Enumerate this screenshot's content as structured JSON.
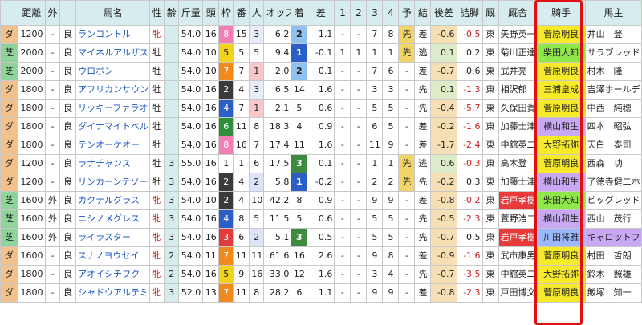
{
  "headers": [
    "",
    "距離",
    "外",
    "",
    "馬名",
    "性",
    "齢",
    "斤量",
    "頭",
    "枠",
    "番",
    "人",
    "オッズ",
    "着",
    "差",
    "1",
    "2",
    "3",
    "4",
    "予",
    "結",
    "後差",
    "詰脚",
    "厩",
    "厩舎",
    "騎手",
    "馬主"
  ],
  "rows": [
    {
      "surf": "ダ",
      "dist": "1200",
      "out": "-",
      "cond": "良",
      "horse": "ランコントル",
      "sex": "牝",
      "age": "",
      "kin": "54.0",
      "tou": "16",
      "waku": "8",
      "ban": "15",
      "pop": "3",
      "odds": "6.2",
      "chaku": "2",
      "sa": "1.1",
      "p1": "-",
      "p2": "-",
      "p3": "7",
      "p4": "8",
      "yo": "先",
      "ke": "差",
      "ato": "-0.6",
      "tsu": "-0.5",
      "umaya": "東",
      "kyu": "矢野英一",
      "jock": "菅原明良",
      "owner": "井山　登"
    },
    {
      "surf": "芝",
      "dist": "2000",
      "out": "-",
      "cond": "良",
      "horse": "マイネルアルザス",
      "sex": "牡",
      "age": "",
      "kin": "54.0",
      "tou": "10",
      "waku": "5",
      "ban": "5",
      "pop": "5",
      "odds": "9.4",
      "chaku": "1",
      "sa": "-0.1",
      "p1": "1",
      "p2": "1",
      "p3": "1",
      "p4": "1",
      "yo": "先",
      "ke": "逃",
      "ato": "0.1",
      "tsu": "0.2",
      "umaya": "東",
      "kyu": "菊川正達",
      "jock": "柴田大知",
      "owner": "サラブレッド"
    },
    {
      "surf": "芝",
      "dist": "2000",
      "out": "-",
      "cond": "良",
      "horse": "ウロボン",
      "sex": "牡",
      "age": "",
      "kin": "54.0",
      "tou": "10",
      "waku": "7",
      "ban": "7",
      "pop": "1",
      "odds": "2.0",
      "chaku": "2",
      "sa": "0.1",
      "p1": "-",
      "p2": "-",
      "p3": "7",
      "p4": "6",
      "yo": "-",
      "ke": "差",
      "ato": "-0.7",
      "tsu": "0.6",
      "umaya": "東",
      "kyu": "武井亮",
      "jock": "菅原明良",
      "owner": "村木　隆"
    },
    {
      "surf": "ダ",
      "dist": "1800",
      "out": "-",
      "cond": "良",
      "horse": "アフリカンサウンズ",
      "sex": "牡",
      "age": "",
      "kin": "54.0",
      "tou": "16",
      "waku": "2",
      "ban": "4",
      "pop": "3",
      "odds": "6.5",
      "chaku": "14",
      "sa": "1.6",
      "p1": "-",
      "p2": "-",
      "p3": "3",
      "p4": "3",
      "yo": "-",
      "ke": "先",
      "ato": "0.1",
      "tsu": "-1.3",
      "umaya": "東",
      "kyu": "相沢郁",
      "jock": "三浦皇成",
      "owner": "吉澤ホールデ"
    },
    {
      "surf": "ダ",
      "dist": "1800",
      "out": "-",
      "cond": "良",
      "horse": "リッキーファラオ",
      "sex": "牡",
      "age": "",
      "kin": "54.0",
      "tou": "16",
      "waku": "4",
      "ban": "7",
      "pop": "1",
      "odds": "2.1",
      "chaku": "5",
      "sa": "0.6",
      "p1": "-",
      "p2": "-",
      "p3": "5",
      "p4": "5",
      "yo": "-",
      "ke": "先",
      "ato": "-0.4",
      "tsu": "-5.7",
      "umaya": "東",
      "kyu": "久保田貴",
      "jock": "菅原明良",
      "owner": "中西　純穂"
    },
    {
      "surf": "ダ",
      "dist": "1800",
      "out": "-",
      "cond": "良",
      "horse": "ダイナマイトベルン",
      "sex": "牡",
      "age": "",
      "kin": "54.0",
      "tou": "16",
      "waku": "6",
      "ban": "11",
      "pop": "8",
      "odds": "18.3",
      "chaku": "4",
      "sa": "0.9",
      "p1": "-",
      "p2": "-",
      "p3": "6",
      "p4": "5",
      "yo": "-",
      "ke": "差",
      "ato": "-0.2",
      "tsu": "-1.6",
      "umaya": "東",
      "kyu": "加藤士津",
      "jock": "横山和生",
      "owner": "四本　昭弘"
    },
    {
      "surf": "ダ",
      "dist": "1800",
      "out": "-",
      "cond": "良",
      "horse": "テンオーケオー",
      "sex": "牡",
      "age": "",
      "kin": "54.0",
      "tou": "16",
      "waku": "8",
      "ban": "16",
      "pop": "7",
      "odds": "17.4",
      "chaku": "11",
      "sa": "1.6",
      "p1": "-",
      "p2": "-",
      "p3": "11",
      "p4": "9",
      "yo": "-",
      "ke": "差",
      "ato": "-1.7",
      "tsu": "-2.4",
      "umaya": "東",
      "kyu": "中舘英二",
      "jock": "大野拓弥",
      "owner": "天白　泰司"
    },
    {
      "surf": "ダ",
      "dist": "1200",
      "out": "-",
      "cond": "良",
      "horse": "ラナチャンス",
      "sex": "牡",
      "age": "3",
      "kin": "55.0",
      "tou": "16",
      "waku": "1",
      "ban": "1",
      "pop": "6",
      "odds": "17.5",
      "chaku": "3",
      "sa": "0.1",
      "p1": "-",
      "p2": "-",
      "p3": "1",
      "p4": "1",
      "yo": "先",
      "ke": "逃",
      "ato": "0.6",
      "tsu": "-0.3",
      "umaya": "東",
      "kyu": "高木登",
      "jock": "菅原明良",
      "owner": "西森　功"
    },
    {
      "surf": "ダ",
      "dist": "1200",
      "out": "-",
      "cond": "良",
      "horse": "リンカーンテソーロ",
      "sex": "牡",
      "age": "3",
      "kin": "54.0",
      "tou": "16",
      "waku": "2",
      "ban": "4",
      "pop": "2",
      "odds": "5.8",
      "chaku": "1",
      "sa": "-0.2",
      "p1": "-",
      "p2": "-",
      "p3": "2",
      "p4": "2",
      "yo": "先",
      "ke": "先",
      "ato": "-0.2",
      "tsu": "0.3",
      "umaya": "東",
      "kyu": "加藤士津",
      "jock": "横山和生",
      "owner": "了徳寺健二ホ"
    },
    {
      "surf": "芝",
      "dist": "1600",
      "out": "外",
      "cond": "良",
      "horse": "カクテルグラス",
      "sex": "牝",
      "age": "3",
      "kin": "54.0",
      "tou": "10",
      "waku": "2",
      "ban": "4",
      "pop": "10",
      "odds": "42.2",
      "chaku": "8",
      "sa": "0.9",
      "p1": "-",
      "p2": "-",
      "p3": "9",
      "p4": "9",
      "yo": "-",
      "ke": "差",
      "ato": "-0.8",
      "tsu": "-0.2",
      "umaya": "東",
      "kyu": "岩戸孝樹",
      "jock": "柴田大知",
      "owner": "ビッグレッド"
    },
    {
      "surf": "芝",
      "dist": "1600",
      "out": "外",
      "cond": "良",
      "horse": "ニシノメグレス",
      "sex": "牝",
      "age": "3",
      "kin": "54.0",
      "tou": "16",
      "waku": "4",
      "ban": "8",
      "pop": "5",
      "odds": "11.5",
      "chaku": "5",
      "sa": "0.6",
      "p1": "-",
      "p2": "-",
      "p3": "5",
      "p4": "5",
      "yo": "-",
      "ke": "先",
      "ato": "-0.5",
      "tsu": "-2.3",
      "umaya": "東",
      "kyu": "萱野浩二",
      "jock": "横山和生",
      "owner": "西山　茂行"
    },
    {
      "surf": "芝",
      "dist": "1600",
      "out": "外",
      "cond": "良",
      "horse": "ライラスター",
      "sex": "牝",
      "age": "3",
      "kin": "54.0",
      "tou": "16",
      "waku": "3",
      "ban": "6",
      "pop": "2",
      "odds": "5.1",
      "chaku": "3",
      "sa": "0.5",
      "p1": "-",
      "p2": "-",
      "p3": "5",
      "p4": "5",
      "yo": "-",
      "ke": "先",
      "ato": "-0.7",
      "tsu": "0.5",
      "umaya": "東",
      "kyu": "岩戸孝樹",
      "jock": "川田将雅",
      "owner": "キャロットフ"
    },
    {
      "surf": "ダ",
      "dist": "1600",
      "out": "-",
      "cond": "良",
      "horse": "スナノヨウセイ",
      "sex": "牝",
      "age": "2",
      "kin": "54.0",
      "tou": "11",
      "waku": "7",
      "ban": "11",
      "pop": "11",
      "odds": "61.6",
      "chaku": "16",
      "sa": "2.6",
      "p1": "-",
      "p2": "-",
      "p3": "9",
      "p4": "8",
      "yo": "-",
      "ke": "差",
      "ato": "-0.9",
      "tsu": "-1.6",
      "umaya": "東",
      "kyu": "武市康男",
      "jock": "菅原明良",
      "owner": "村田　哲朗"
    },
    {
      "surf": "ダ",
      "dist": "1800",
      "out": "-",
      "cond": "良",
      "horse": "アオイシチフク",
      "sex": "牝",
      "age": "2",
      "kin": "54.0",
      "tou": "16",
      "waku": "5",
      "ban": "9",
      "pop": "16",
      "odds": "33.0",
      "chaku": "12",
      "sa": "1.6",
      "p1": "-",
      "p2": "-",
      "p3": "3",
      "p4": "4",
      "yo": "-",
      "ke": "先",
      "ato": "-0.7",
      "tsu": "-3.5",
      "umaya": "東",
      "kyu": "中舘英二",
      "jock": "大野拓弥",
      "owner": "鈴木　照雄"
    },
    {
      "surf": "ダ",
      "dist": "1800",
      "out": "-",
      "cond": "良",
      "horse": "シャドウアルテミス",
      "sex": "牝",
      "age": "3",
      "kin": "52.0",
      "tou": "13",
      "waku": "7",
      "ban": "11",
      "pop": "8",
      "odds": "28.2",
      "chaku": "6",
      "sa": "1.1",
      "p1": "-",
      "p2": "-",
      "p3": "9",
      "p4": "9",
      "yo": "-",
      "ke": "差",
      "ato": "-0.8",
      "tsu": "-2.3",
      "umaya": "東",
      "kyu": "戸田博文",
      "jock": "菅原明良",
      "owner": "飯塚　知一"
    }
  ],
  "colors": {
    "highlight_border": "#e01010",
    "header_bg": "#d7ecee"
  }
}
